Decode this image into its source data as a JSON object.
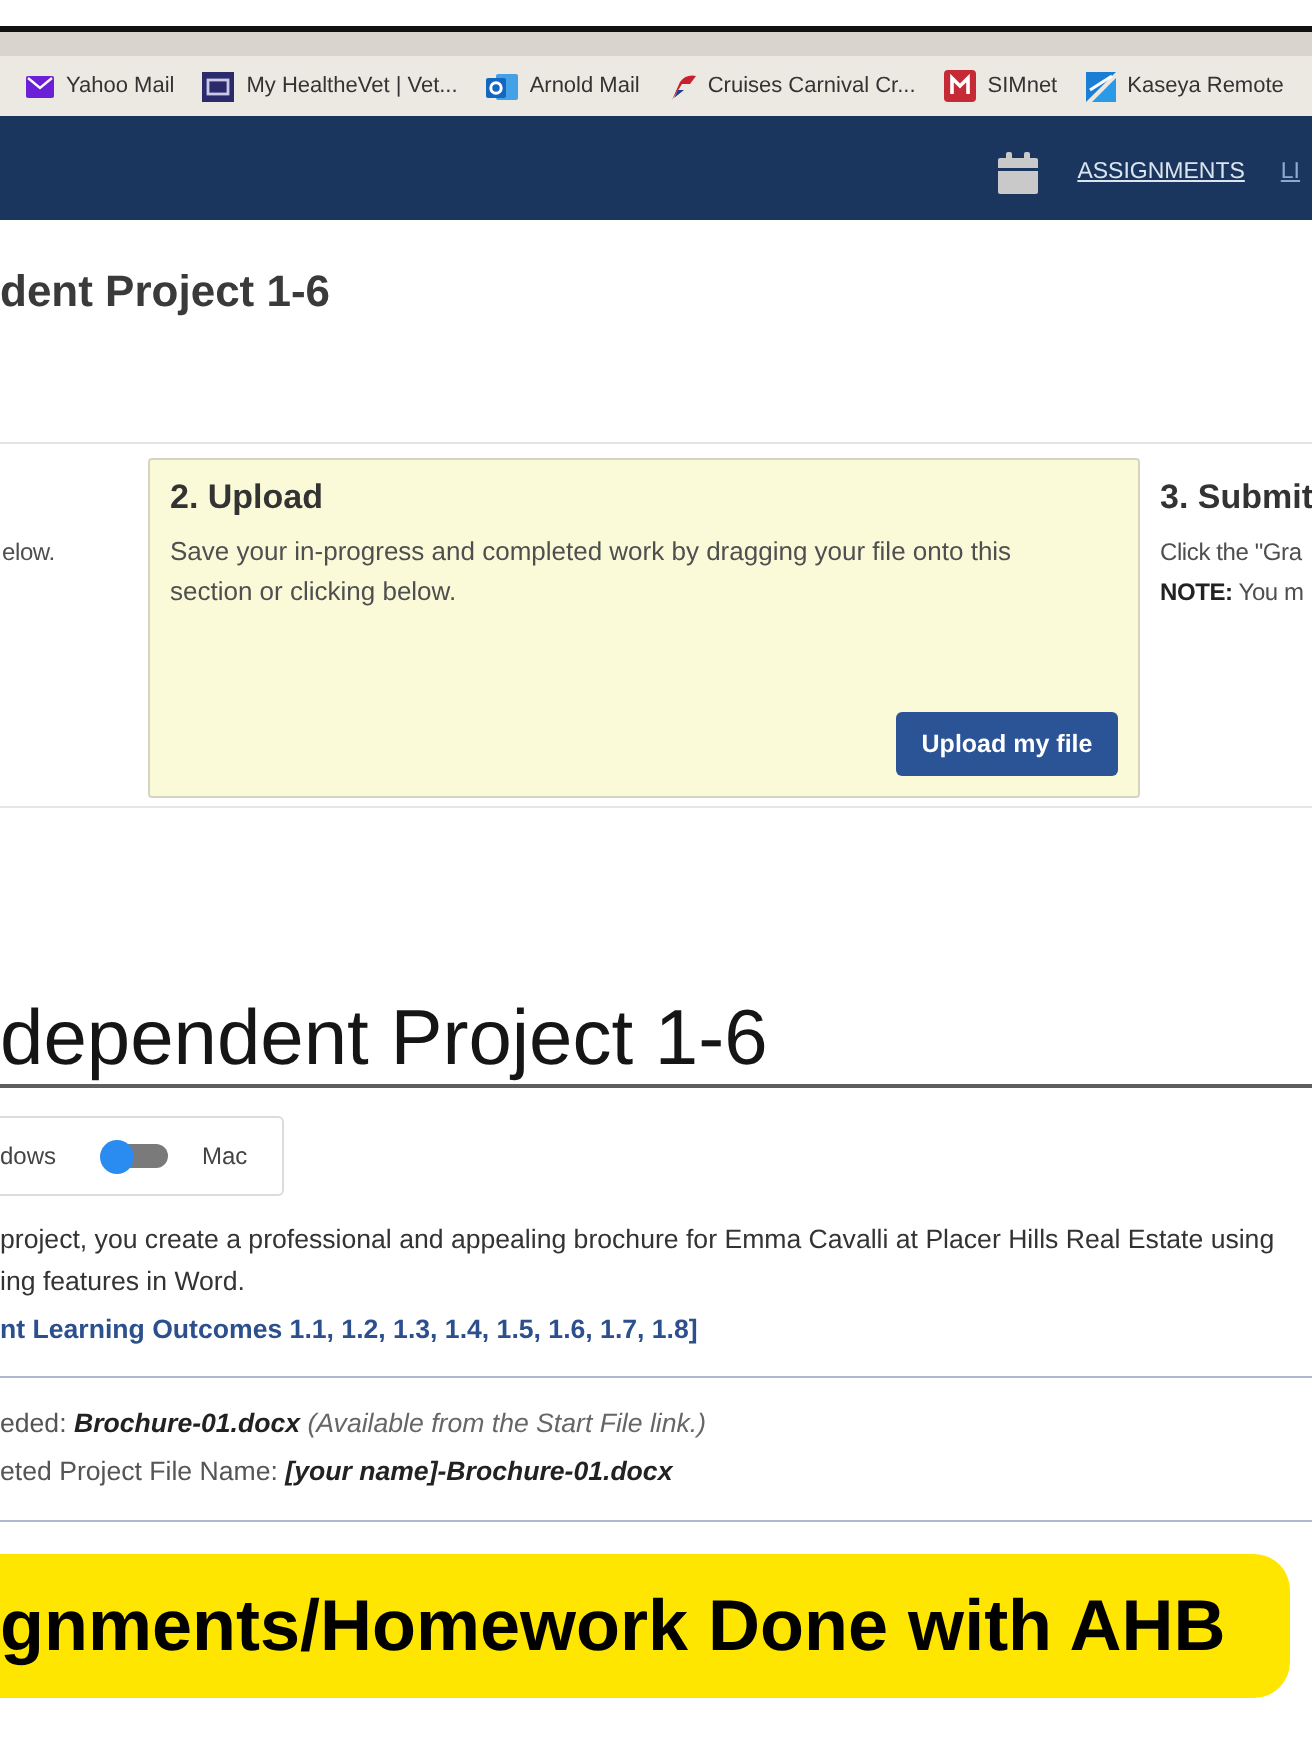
{
  "browser": {
    "bookmarks": [
      {
        "label": "Yahoo Mail",
        "kind": "envelope"
      },
      {
        "label": "My HealtheVet | Vet...",
        "kind": "badge"
      },
      {
        "label": "Arnold Mail",
        "kind": "circle-tile"
      },
      {
        "label": "Cruises Carnival Cr...",
        "kind": "funnel"
      },
      {
        "label": "SIMnet",
        "kind": "m-tile"
      },
      {
        "label": "Kaseya Remote",
        "kind": "kite"
      }
    ]
  },
  "nav": {
    "links": [
      {
        "label": "ASSIGNMENTS",
        "dim": false
      },
      {
        "label": "LI",
        "dim": true
      }
    ]
  },
  "page_title": "dent Project 1-6",
  "steps": [
    {
      "kind": "info",
      "lines": [
        "elow."
      ]
    },
    {
      "kind": "dropzone",
      "title": "2. Upload",
      "lines": [
        "Save your in-progress and completed work by dragging your file onto this section or clicking below."
      ],
      "button": "Upload my file"
    },
    {
      "kind": "info",
      "title": "3. Submit",
      "lines": [
        "Click the \"Gra",
        "**NOTE:** You m"
      ]
    }
  ],
  "project": {
    "heading": "dependent Project 1-6",
    "os_toggle": {
      "left_label": "dows",
      "right_label": "Mac",
      "mac_selected": false
    },
    "description": [
      "project, you create a professional and appealing brochure for Emma Cavalli at Placer Hills Real Estate using",
      "ing features in Word."
    ],
    "outcomes": "nt Learning Outcomes 1.1, 1.2, 1.3, 1.4, 1.5, 1.6, 1.7, 1.8]",
    "files": [
      {
        "label": "eded:",
        "file": "Brochure-01.docx",
        "note": "(Available from the Start File link.)"
      },
      {
        "label": "eted Project File Name:",
        "file": "[your name]-Brochure-01.docx"
      }
    ]
  },
  "banner": {
    "text": "gnments/Homework Done with AHB"
  }
}
